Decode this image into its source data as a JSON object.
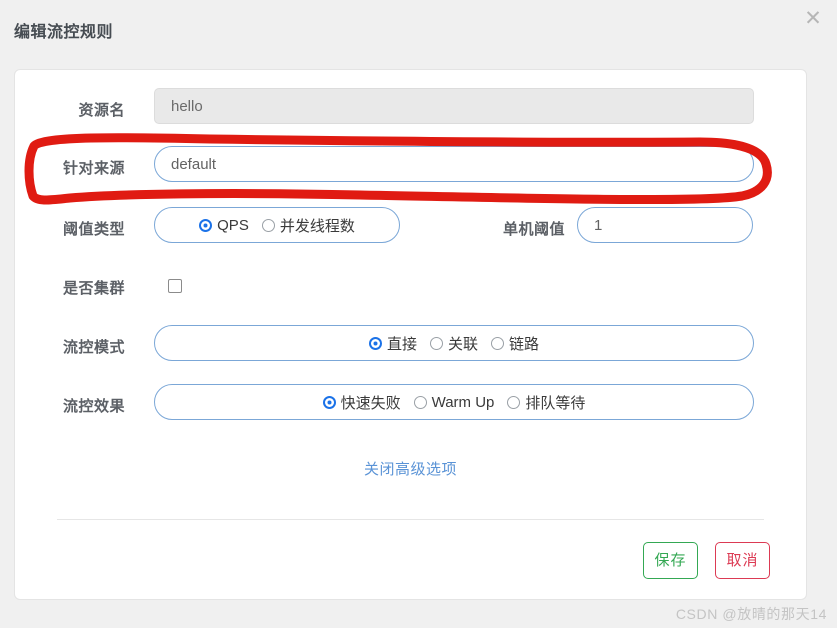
{
  "dialog": {
    "title": "编辑流控规则",
    "close_icon": "close-icon"
  },
  "form": {
    "resource": {
      "label": "资源名",
      "value": "hello",
      "readonly": true
    },
    "origin": {
      "label": "针对来源",
      "value": "default",
      "placeholder": "default"
    },
    "threshold_type": {
      "label": "阈值类型",
      "options": [
        {
          "label": "QPS",
          "checked": true
        },
        {
          "label": "并发线程数",
          "checked": false
        }
      ]
    },
    "single_threshold": {
      "label": "单机阈值",
      "value": "1"
    },
    "cluster": {
      "label": "是否集群",
      "checked": false
    },
    "flow_mode": {
      "label": "流控模式",
      "options": [
        {
          "label": "直接",
          "checked": true
        },
        {
          "label": "关联",
          "checked": false
        },
        {
          "label": "链路",
          "checked": false
        }
      ]
    },
    "flow_effect": {
      "label": "流控效果",
      "options": [
        {
          "label": "快速失败",
          "checked": true
        },
        {
          "label": "Warm Up",
          "checked": false
        },
        {
          "label": "排队等待",
          "checked": false
        }
      ]
    },
    "advanced_toggle": "关闭高级选项"
  },
  "footer": {
    "save_label": "保存",
    "cancel_label": "取消"
  },
  "annotation": {
    "color": "#e01b12",
    "target": "针对来源"
  },
  "watermark": "CSDN @放晴的那天14"
}
